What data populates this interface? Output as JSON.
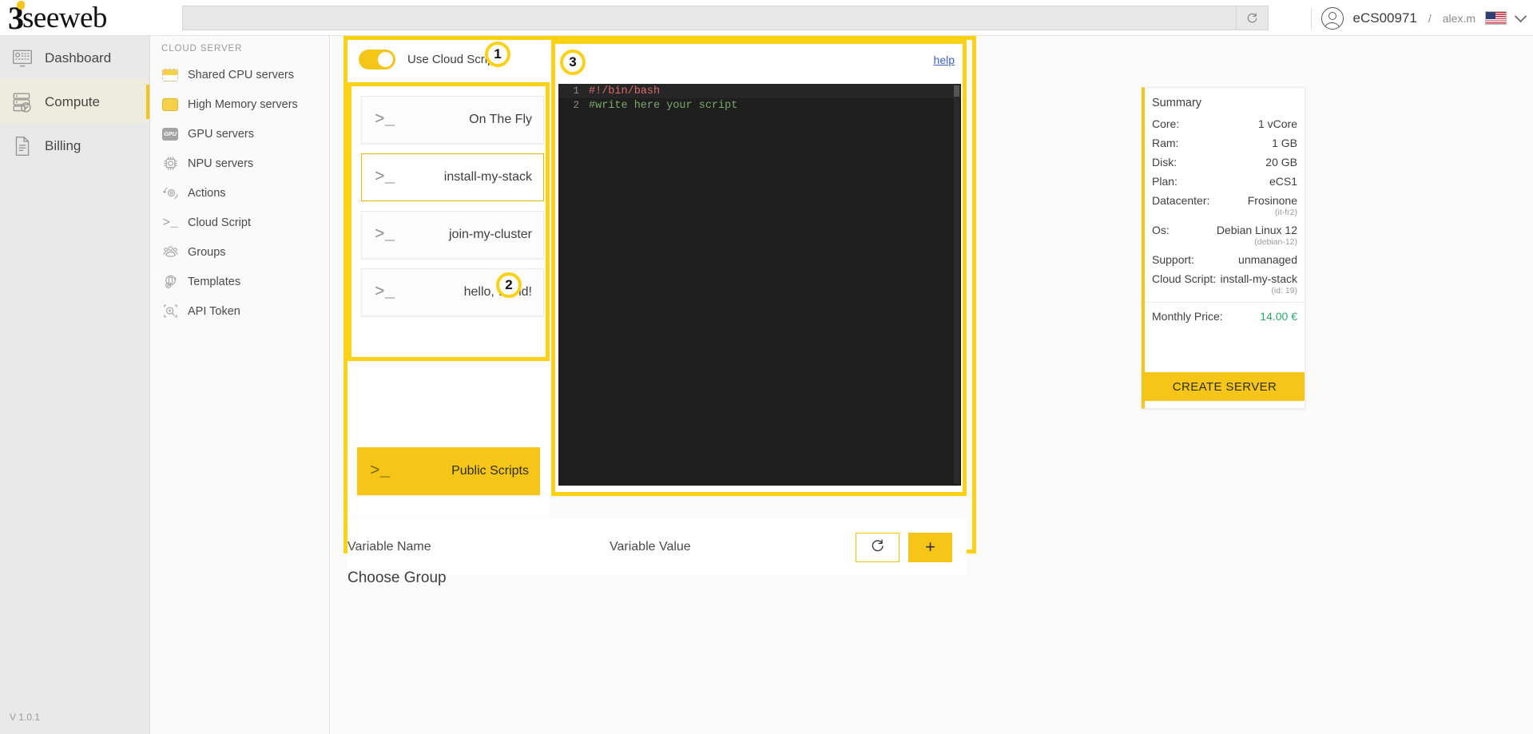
{
  "header": {
    "logo_mark": "3",
    "logo_text": "seeweb",
    "search_placeholder": "",
    "search_value": "",
    "refresh_icon": "refresh-icon",
    "account_id": "eCS00971",
    "separator": "/",
    "user_name": "alex.m",
    "flag_icon": "us-flag-icon",
    "chevron_icon": "chevron-down-icon"
  },
  "rail": {
    "items": [
      {
        "label": "Dashboard",
        "icon": "dashboard-icon",
        "active": false
      },
      {
        "label": "Compute",
        "icon": "server-stack-icon",
        "active": true
      },
      {
        "label": "Billing",
        "icon": "document-icon",
        "active": false
      }
    ],
    "version": "V 1.0.1"
  },
  "subnav": {
    "title": "CLOUD SERVER",
    "items": [
      {
        "label": "Shared CPU servers",
        "icon": "cpu-chip-half-icon"
      },
      {
        "label": "High Memory servers",
        "icon": "cpu-chip-full-icon"
      },
      {
        "label": "GPU servers",
        "icon": "gpu-chip-icon"
      },
      {
        "label": "NPU servers",
        "icon": "npu-chip-icon"
      },
      {
        "label": "Actions",
        "icon": "actions-gear-icon"
      },
      {
        "label": "Cloud Script",
        "icon": "terminal-prompt-icon"
      },
      {
        "label": "Groups",
        "icon": "groups-icon"
      },
      {
        "label": "Templates",
        "icon": "templates-icon"
      },
      {
        "label": "API Token",
        "icon": "api-token-icon"
      }
    ]
  },
  "collapse": {
    "icon": "double-chevron-left-icon"
  },
  "cloud_scripts": {
    "badges": {
      "one": "1",
      "two": "2",
      "three": "3"
    },
    "toggle_label": "Use Cloud Scripts",
    "toggle_on": true,
    "scripts": [
      {
        "label": "On The Fly",
        "icon": "terminal-prompt-icon",
        "selected": false
      },
      {
        "label": "install-my-stack",
        "icon": "terminal-prompt-icon",
        "selected": true
      },
      {
        "label": "join-my-cluster",
        "icon": "terminal-prompt-icon",
        "selected": false
      },
      {
        "label": "hello, world!",
        "icon": "terminal-prompt-icon",
        "selected": false
      }
    ],
    "public_scripts_label": "Public Scripts"
  },
  "editor": {
    "help_label": "help",
    "lines": [
      {
        "no": "1",
        "text": "#!/bin/bash",
        "color": "red"
      },
      {
        "no": "2",
        "text": "#write here your script",
        "color": "green"
      }
    ]
  },
  "variables": {
    "name_label": "Variable Name",
    "value_label": "Variable Value",
    "reset_icon": "reset-circular-arrow-icon",
    "add_label": "+"
  },
  "choose_group_label": "Choose Group",
  "summary": {
    "title": "Summary",
    "rows": [
      {
        "key": "Core:",
        "value": "1 vCore",
        "sub": ""
      },
      {
        "key": "Ram:",
        "value": "1 GB",
        "sub": ""
      },
      {
        "key": "Disk:",
        "value": "20 GB",
        "sub": ""
      },
      {
        "key": "Plan:",
        "value": "eCS1",
        "sub": ""
      },
      {
        "key": "Datacenter:",
        "value": "Frosinone",
        "sub": "(it-fr2)"
      },
      {
        "key": "Os:",
        "value": "Debian Linux 12",
        "sub": "(debian-12)"
      },
      {
        "key": "Support:",
        "value": "unmanaged",
        "sub": ""
      },
      {
        "key": "Cloud Script:",
        "value": "install-my-stack",
        "sub": "(id: 19)"
      },
      {
        "key": "Monthly Price:",
        "value": "14.00 €",
        "sub": "",
        "price": true
      }
    ],
    "create_button": "CREATE SERVER"
  },
  "colors": {
    "brand_yellow": "#F5C518",
    "highlight_yellow": "#FCD116",
    "price_green": "#2fa968",
    "link_blue": "#3b63c6",
    "editor_bg": "#1e1e1e"
  }
}
